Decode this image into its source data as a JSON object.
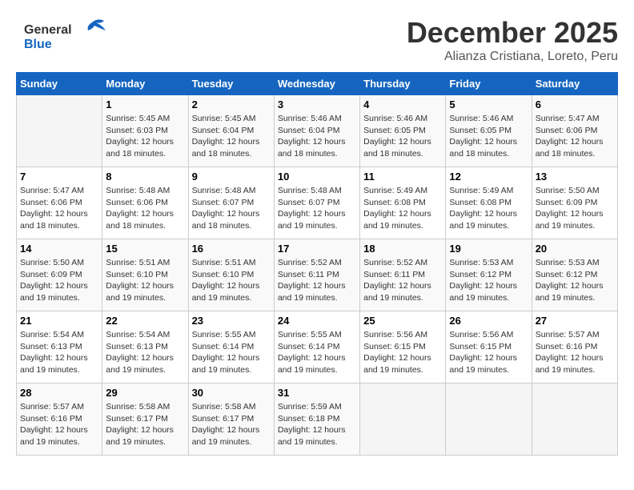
{
  "header": {
    "logo_line1": "General",
    "logo_line2": "Blue",
    "month_title": "December 2025",
    "subtitle": "Alianza Cristiana, Loreto, Peru"
  },
  "days_of_week": [
    "Sunday",
    "Monday",
    "Tuesday",
    "Wednesday",
    "Thursday",
    "Friday",
    "Saturday"
  ],
  "weeks": [
    [
      {
        "day": "",
        "sunrise": "",
        "sunset": "",
        "daylight": ""
      },
      {
        "day": "1",
        "sunrise": "Sunrise: 5:45 AM",
        "sunset": "Sunset: 6:03 PM",
        "daylight": "Daylight: 12 hours and 18 minutes."
      },
      {
        "day": "2",
        "sunrise": "Sunrise: 5:45 AM",
        "sunset": "Sunset: 6:04 PM",
        "daylight": "Daylight: 12 hours and 18 minutes."
      },
      {
        "day": "3",
        "sunrise": "Sunrise: 5:46 AM",
        "sunset": "Sunset: 6:04 PM",
        "daylight": "Daylight: 12 hours and 18 minutes."
      },
      {
        "day": "4",
        "sunrise": "Sunrise: 5:46 AM",
        "sunset": "Sunset: 6:05 PM",
        "daylight": "Daylight: 12 hours and 18 minutes."
      },
      {
        "day": "5",
        "sunrise": "Sunrise: 5:46 AM",
        "sunset": "Sunset: 6:05 PM",
        "daylight": "Daylight: 12 hours and 18 minutes."
      },
      {
        "day": "6",
        "sunrise": "Sunrise: 5:47 AM",
        "sunset": "Sunset: 6:06 PM",
        "daylight": "Daylight: 12 hours and 18 minutes."
      }
    ],
    [
      {
        "day": "7",
        "sunrise": "Sunrise: 5:47 AM",
        "sunset": "Sunset: 6:06 PM",
        "daylight": "Daylight: 12 hours and 18 minutes."
      },
      {
        "day": "8",
        "sunrise": "Sunrise: 5:48 AM",
        "sunset": "Sunset: 6:06 PM",
        "daylight": "Daylight: 12 hours and 18 minutes."
      },
      {
        "day": "9",
        "sunrise": "Sunrise: 5:48 AM",
        "sunset": "Sunset: 6:07 PM",
        "daylight": "Daylight: 12 hours and 18 minutes."
      },
      {
        "day": "10",
        "sunrise": "Sunrise: 5:48 AM",
        "sunset": "Sunset: 6:07 PM",
        "daylight": "Daylight: 12 hours and 19 minutes."
      },
      {
        "day": "11",
        "sunrise": "Sunrise: 5:49 AM",
        "sunset": "Sunset: 6:08 PM",
        "daylight": "Daylight: 12 hours and 19 minutes."
      },
      {
        "day": "12",
        "sunrise": "Sunrise: 5:49 AM",
        "sunset": "Sunset: 6:08 PM",
        "daylight": "Daylight: 12 hours and 19 minutes."
      },
      {
        "day": "13",
        "sunrise": "Sunrise: 5:50 AM",
        "sunset": "Sunset: 6:09 PM",
        "daylight": "Daylight: 12 hours and 19 minutes."
      }
    ],
    [
      {
        "day": "14",
        "sunrise": "Sunrise: 5:50 AM",
        "sunset": "Sunset: 6:09 PM",
        "daylight": "Daylight: 12 hours and 19 minutes."
      },
      {
        "day": "15",
        "sunrise": "Sunrise: 5:51 AM",
        "sunset": "Sunset: 6:10 PM",
        "daylight": "Daylight: 12 hours and 19 minutes."
      },
      {
        "day": "16",
        "sunrise": "Sunrise: 5:51 AM",
        "sunset": "Sunset: 6:10 PM",
        "daylight": "Daylight: 12 hours and 19 minutes."
      },
      {
        "day": "17",
        "sunrise": "Sunrise: 5:52 AM",
        "sunset": "Sunset: 6:11 PM",
        "daylight": "Daylight: 12 hours and 19 minutes."
      },
      {
        "day": "18",
        "sunrise": "Sunrise: 5:52 AM",
        "sunset": "Sunset: 6:11 PM",
        "daylight": "Daylight: 12 hours and 19 minutes."
      },
      {
        "day": "19",
        "sunrise": "Sunrise: 5:53 AM",
        "sunset": "Sunset: 6:12 PM",
        "daylight": "Daylight: 12 hours and 19 minutes."
      },
      {
        "day": "20",
        "sunrise": "Sunrise: 5:53 AM",
        "sunset": "Sunset: 6:12 PM",
        "daylight": "Daylight: 12 hours and 19 minutes."
      }
    ],
    [
      {
        "day": "21",
        "sunrise": "Sunrise: 5:54 AM",
        "sunset": "Sunset: 6:13 PM",
        "daylight": "Daylight: 12 hours and 19 minutes."
      },
      {
        "day": "22",
        "sunrise": "Sunrise: 5:54 AM",
        "sunset": "Sunset: 6:13 PM",
        "daylight": "Daylight: 12 hours and 19 minutes."
      },
      {
        "day": "23",
        "sunrise": "Sunrise: 5:55 AM",
        "sunset": "Sunset: 6:14 PM",
        "daylight": "Daylight: 12 hours and 19 minutes."
      },
      {
        "day": "24",
        "sunrise": "Sunrise: 5:55 AM",
        "sunset": "Sunset: 6:14 PM",
        "daylight": "Daylight: 12 hours and 19 minutes."
      },
      {
        "day": "25",
        "sunrise": "Sunrise: 5:56 AM",
        "sunset": "Sunset: 6:15 PM",
        "daylight": "Daylight: 12 hours and 19 minutes."
      },
      {
        "day": "26",
        "sunrise": "Sunrise: 5:56 AM",
        "sunset": "Sunset: 6:15 PM",
        "daylight": "Daylight: 12 hours and 19 minutes."
      },
      {
        "day": "27",
        "sunrise": "Sunrise: 5:57 AM",
        "sunset": "Sunset: 6:16 PM",
        "daylight": "Daylight: 12 hours and 19 minutes."
      }
    ],
    [
      {
        "day": "28",
        "sunrise": "Sunrise: 5:57 AM",
        "sunset": "Sunset: 6:16 PM",
        "daylight": "Daylight: 12 hours and 19 minutes."
      },
      {
        "day": "29",
        "sunrise": "Sunrise: 5:58 AM",
        "sunset": "Sunset: 6:17 PM",
        "daylight": "Daylight: 12 hours and 19 minutes."
      },
      {
        "day": "30",
        "sunrise": "Sunrise: 5:58 AM",
        "sunset": "Sunset: 6:17 PM",
        "daylight": "Daylight: 12 hours and 19 minutes."
      },
      {
        "day": "31",
        "sunrise": "Sunrise: 5:59 AM",
        "sunset": "Sunset: 6:18 PM",
        "daylight": "Daylight: 12 hours and 19 minutes."
      },
      {
        "day": "",
        "sunrise": "",
        "sunset": "",
        "daylight": ""
      },
      {
        "day": "",
        "sunrise": "",
        "sunset": "",
        "daylight": ""
      },
      {
        "day": "",
        "sunrise": "",
        "sunset": "",
        "daylight": ""
      }
    ]
  ]
}
